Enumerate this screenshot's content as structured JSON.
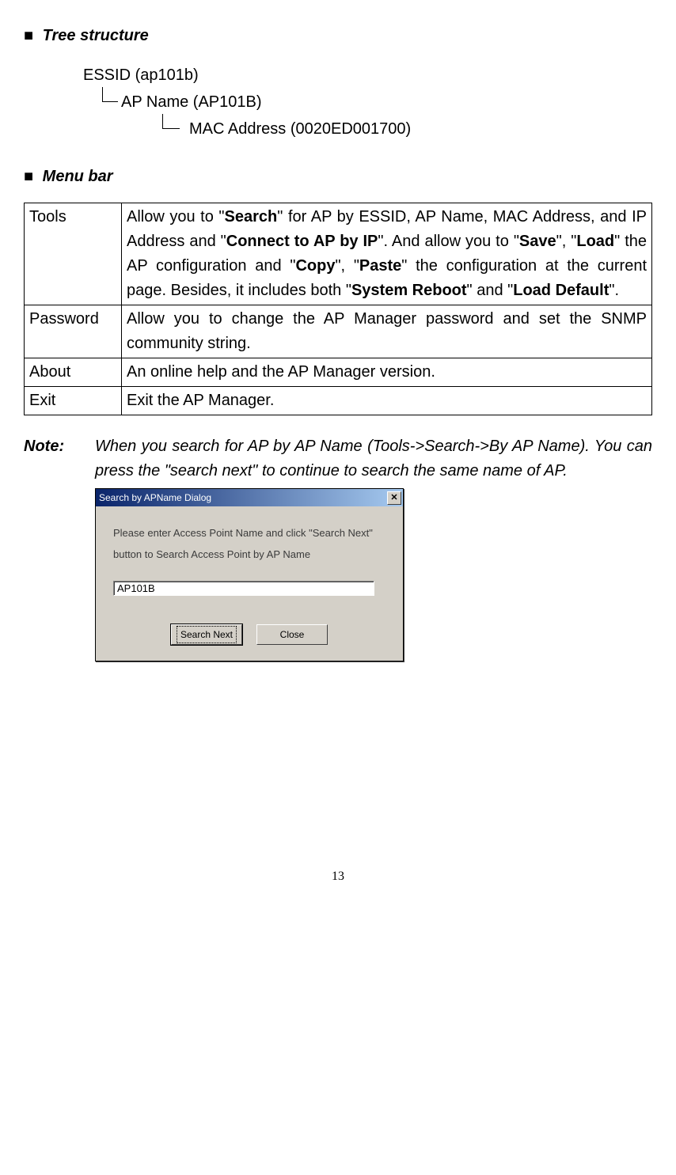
{
  "sections": {
    "tree_header": "Tree structure",
    "menu_header": "Menu bar"
  },
  "tree": {
    "essid": "ESSID (ap101b)",
    "apname": "AP Name (AP101B)",
    "mac": "MAC Address (0020ED001700)"
  },
  "menu": {
    "rows": [
      {
        "name": "Tools"
      },
      {
        "name": "Password"
      },
      {
        "name": "About"
      },
      {
        "name": "Exit"
      }
    ],
    "tools": {
      "p1": "Allow you to \"",
      "search": "Search",
      "p2": "\" for AP by ESSID, AP Name, MAC Address, and IP Address and \"",
      "connect": "Connect to AP by IP",
      "p3": "\". And allow you to \"",
      "save": "Save",
      "p4": "\", \"",
      "load": "Load",
      "p5": "\" the AP configuration and \"",
      "copy": "Copy",
      "p6": "\", \"",
      "paste": "Paste",
      "p7": "\" the configuration at the current page. Besides, it includes both \"",
      "reboot": "System Reboot",
      "p8": "\" and \"",
      "default": "Load Default",
      "p9": "\"."
    },
    "password_desc": "Allow you to change the AP Manager password and set the SNMP community string.",
    "about_desc": "An online help and the AP Manager version.",
    "exit_desc": "Exit the AP Manager."
  },
  "note": {
    "label": "Note:",
    "text": "When you search for AP by AP Name (Tools->Search->By AP Name). You can press the \"search next\" to continue to search the same name of AP."
  },
  "dialog": {
    "title": "Search by APName Dialog",
    "instruction": "Please enter Access Point Name and click \"Search Next\" button to Search Access Point by AP Name",
    "input_value": "AP101B",
    "btn_search": "Search Next",
    "btn_close": "Close",
    "close_x": "✕"
  },
  "page_number": "13"
}
